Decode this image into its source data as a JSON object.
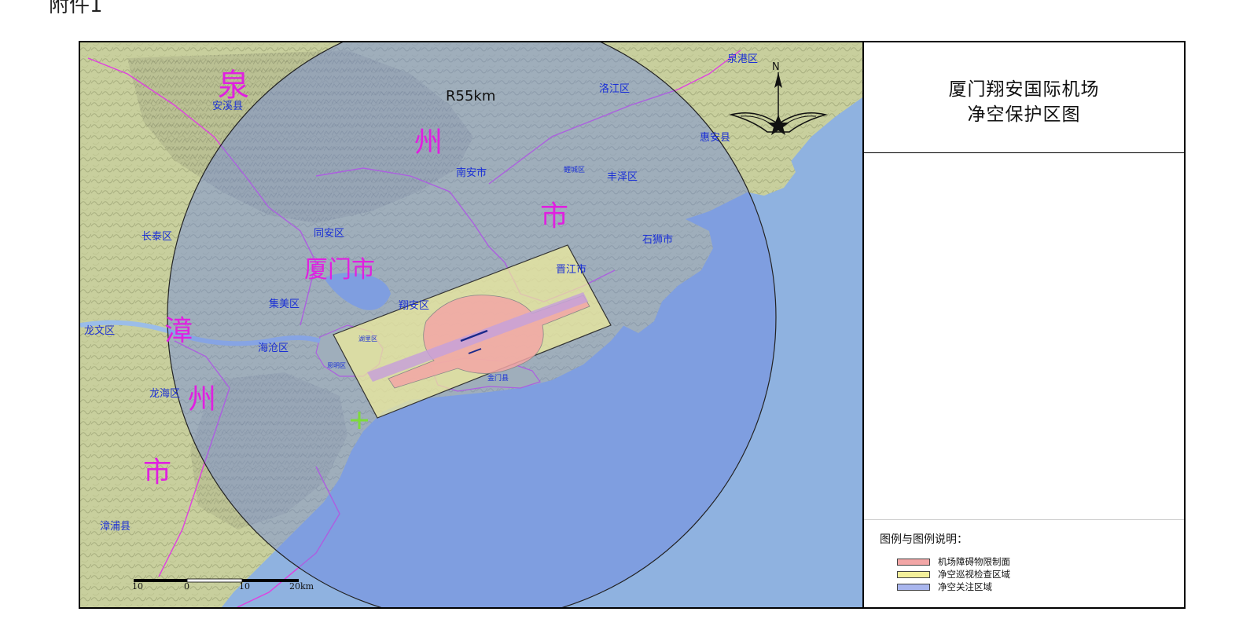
{
  "header_note": "附件1",
  "map_title": {
    "line1": "厦门翔安国际机场",
    "line2": "净空保护区图"
  },
  "radius_label": "R55km",
  "compass_letter": "N",
  "cities_large": {
    "quan_1": "泉",
    "quan_2": "州",
    "quan_3": "市",
    "zhang_1": "漳",
    "zhang_2": "州",
    "zhang_3": "市",
    "xiamen": "厦门市"
  },
  "districts": {
    "anxi": "安溪县",
    "quangang": "泉港区",
    "luojiang": "洛江区",
    "huian": "惠安县",
    "nanan": "南安市",
    "licheng": "鲤城区",
    "fengze": "丰泽区",
    "shishi": "石狮市",
    "jinjiang": "晋江市",
    "changtai": "长泰区",
    "tongan": "同安区",
    "jimei": "集美区",
    "xiangan": "翔安区",
    "longwen": "龙文区",
    "haicang": "海沧区",
    "huli": "湖里区",
    "siming": "思明区",
    "jinmen": "金门县",
    "longhai": "龙海区",
    "zhangpu": "漳浦县"
  },
  "scale_bar": {
    "ticks": [
      "10",
      "0",
      "10",
      "20km"
    ]
  },
  "legend": {
    "title": "图例与图例说明：",
    "items": [
      {
        "label": "机场障碍物限制面",
        "color": "#f2a6a6"
      },
      {
        "label": "净空巡视检查区域",
        "color": "#f3ef9a"
      },
      {
        "label": "净空关注区域",
        "color": "#a9b6ee"
      }
    ]
  },
  "colors": {
    "sea": "#8fb2e0",
    "land": "#c9cfa0",
    "protection_circle": "#6d86e0",
    "admin_boundary": "#e040e0",
    "district_label": "#1a2fd6",
    "city_label": "#e020e0"
  }
}
